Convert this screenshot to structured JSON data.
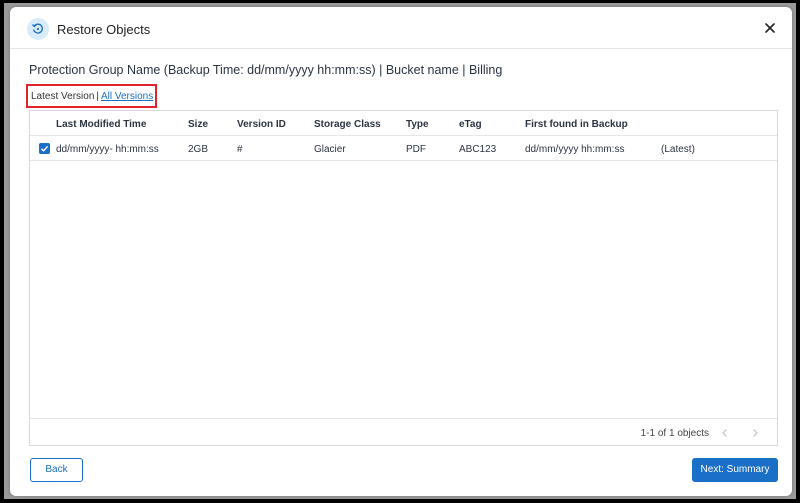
{
  "dialog": {
    "title": "Restore Objects",
    "context_title": "Protection Group Name (Backup Time: dd/mm/yyyy hh:mm:ss) | Bucket name | Billing"
  },
  "version_filter": {
    "latest_label": "Latest Version",
    "separator": "|",
    "all_label": "All Versions"
  },
  "table": {
    "columns": [
      "Last Modified Time",
      "Size",
      "Version ID",
      "Storage Class",
      "Type",
      "eTag",
      "First found in Backup"
    ],
    "rows": [
      {
        "checked": true,
        "last_modified": "dd/mm/yyyy- hh:mm:ss",
        "size": "2GB",
        "version_id": "#",
        "storage_class": "Glacier",
        "type": "PDF",
        "etag": "ABC123",
        "first_found": "dd/mm/yyyy hh:mm:ss",
        "tag": "(Latest)"
      }
    ],
    "pagination": "1-1 of 1 objects"
  },
  "footer": {
    "back_label": "Back",
    "next_label": "Next: Summary"
  },
  "icons": {
    "title": "restore-icon",
    "close": "close-icon",
    "checkbox": "checkmark-icon",
    "prev": "chevron-left-icon",
    "next": "chevron-right-icon"
  },
  "colors": {
    "accent": "#1a6fc6",
    "highlight_box": "#e0242a",
    "icon_bg": "#d9ebf8",
    "backdrop": "#9a9a9a"
  }
}
